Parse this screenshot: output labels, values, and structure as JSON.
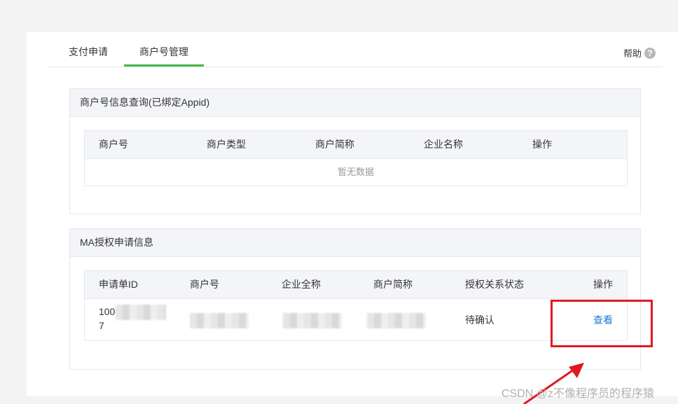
{
  "page": {
    "title_fragment": ""
  },
  "tabs": [
    {
      "label": "支付申请",
      "active": false
    },
    {
      "label": "商户号管理",
      "active": true
    }
  ],
  "help": {
    "label": "帮助",
    "icon": "question-circle-icon"
  },
  "panel1": {
    "title": "商户号信息查询(已绑定Appid)",
    "columns": [
      "商户号",
      "商户类型",
      "商户简称",
      "企业名称",
      "操作"
    ],
    "empty_text": "暂无数据"
  },
  "panel2": {
    "title": "MA授权申请信息",
    "columns": [
      "申请单ID",
      "商户号",
      "企业全称",
      "商户简称",
      "授权关系状态",
      "操作"
    ],
    "rows": [
      {
        "application_id_line1": "100",
        "application_id_line2": "7",
        "status": "待确认",
        "action": "查看"
      }
    ]
  },
  "annotation": {
    "highlight_color": "#e0191f"
  },
  "watermark": "CSDN @z不像程序员的程序猿",
  "colors": {
    "accent_green": "#44b549",
    "link_blue": "#1e7bd6",
    "header_bg": "#f4f5f9"
  }
}
